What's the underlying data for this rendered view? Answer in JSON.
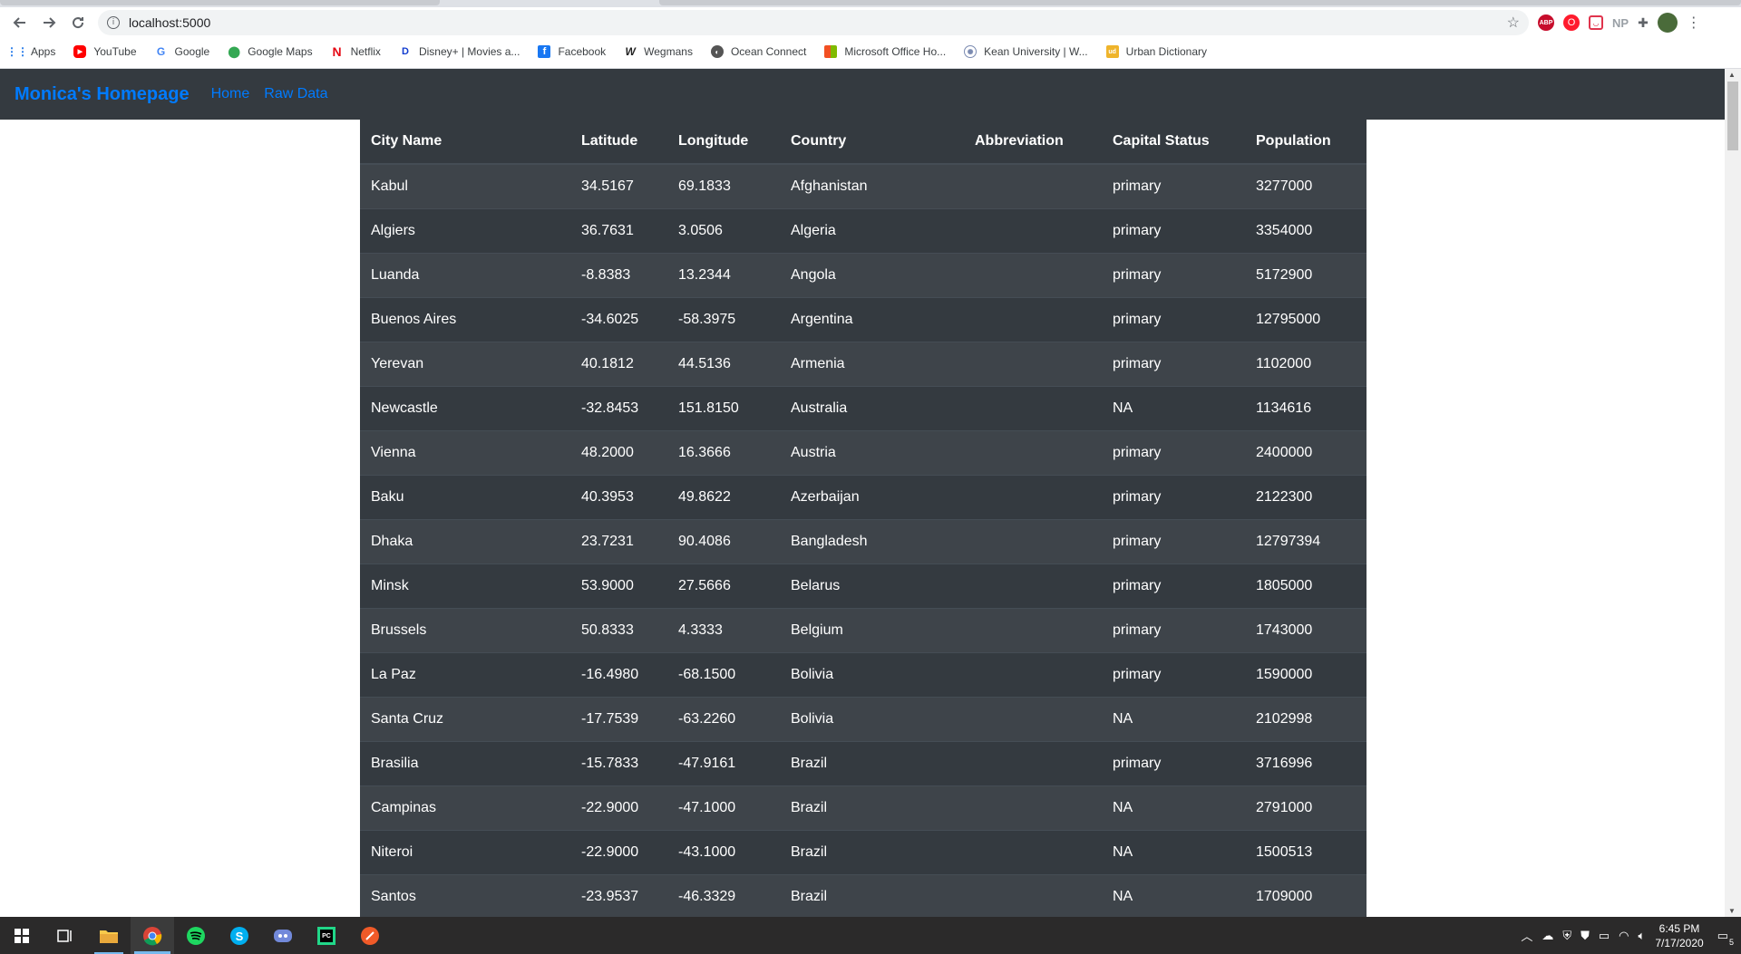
{
  "browser": {
    "url": "localhost:5000",
    "bookmarks": [
      {
        "label": "Apps",
        "icon": "apps-grid-icon"
      },
      {
        "label": "YouTube",
        "icon": "youtube-icon"
      },
      {
        "label": "Google",
        "icon": "google-icon"
      },
      {
        "label": "Google Maps",
        "icon": "google-maps-icon"
      },
      {
        "label": "Netflix",
        "icon": "netflix-icon"
      },
      {
        "label": "Disney+ | Movies a...",
        "icon": "disney-plus-icon"
      },
      {
        "label": "Facebook",
        "icon": "facebook-icon"
      },
      {
        "label": "Wegmans",
        "icon": "wegmans-icon"
      },
      {
        "label": "Ocean Connect",
        "icon": "ocean-connect-icon"
      },
      {
        "label": "Microsoft Office Ho...",
        "icon": "microsoft-office-icon"
      },
      {
        "label": "Kean University | W...",
        "icon": "kean-university-icon"
      },
      {
        "label": "Urban Dictionary",
        "icon": "urban-dictionary-icon"
      }
    ],
    "extensions": {
      "abp": "ABP",
      "np": "NP"
    }
  },
  "navbar": {
    "brand": "Monica's Homepage",
    "links": [
      "Home",
      "Raw Data"
    ]
  },
  "table": {
    "headers": [
      "City Name",
      "Latitude",
      "Longitude",
      "Country",
      "Abbreviation",
      "Capital Status",
      "Population"
    ],
    "rows": [
      [
        "Kabul",
        "34.5167",
        "69.1833",
        "Afghanistan",
        "",
        "primary",
        "3277000"
      ],
      [
        "Algiers",
        "36.7631",
        "3.0506",
        "Algeria",
        "",
        "primary",
        "3354000"
      ],
      [
        "Luanda",
        "-8.8383",
        "13.2344",
        "Angola",
        "",
        "primary",
        "5172900"
      ],
      [
        "Buenos Aires",
        "-34.6025",
        "-58.3975",
        "Argentina",
        "",
        "primary",
        "12795000"
      ],
      [
        "Yerevan",
        "40.1812",
        "44.5136",
        "Armenia",
        "",
        "primary",
        "1102000"
      ],
      [
        "Newcastle",
        "-32.8453",
        "151.8150",
        "Australia",
        "",
        "NA",
        "1134616"
      ],
      [
        "Vienna",
        "48.2000",
        "16.3666",
        "Austria",
        "",
        "primary",
        "2400000"
      ],
      [
        "Baku",
        "40.3953",
        "49.8622",
        "Azerbaijan",
        "",
        "primary",
        "2122300"
      ],
      [
        "Dhaka",
        "23.7231",
        "90.4086",
        "Bangladesh",
        "",
        "primary",
        "12797394"
      ],
      [
        "Minsk",
        "53.9000",
        "27.5666",
        "Belarus",
        "",
        "primary",
        "1805000"
      ],
      [
        "Brussels",
        "50.8333",
        "4.3333",
        "Belgium",
        "",
        "primary",
        "1743000"
      ],
      [
        "La Paz",
        "-16.4980",
        "-68.1500",
        "Bolivia",
        "",
        "primary",
        "1590000"
      ],
      [
        "Santa Cruz",
        "-17.7539",
        "-63.2260",
        "Bolivia",
        "",
        "NA",
        "2102998"
      ],
      [
        "Brasilia",
        "-15.7833",
        "-47.9161",
        "Brazil",
        "",
        "primary",
        "3716996"
      ],
      [
        "Campinas",
        "-22.9000",
        "-47.1000",
        "Brazil",
        "",
        "NA",
        "2791000"
      ],
      [
        "Niteroi",
        "-22.9000",
        "-43.1000",
        "Brazil",
        "",
        "NA",
        "1500513"
      ],
      [
        "Santos",
        "-23.9537",
        "-46.3329",
        "Brazil",
        "",
        "NA",
        "1709000"
      ]
    ]
  },
  "taskbar": {
    "apps": [
      {
        "icon": "windows-start-icon"
      },
      {
        "icon": "task-view-icon"
      },
      {
        "icon": "file-explorer-icon"
      },
      {
        "icon": "chrome-icon"
      },
      {
        "icon": "spotify-icon"
      },
      {
        "icon": "skype-icon"
      },
      {
        "icon": "discord-icon"
      },
      {
        "icon": "pycharm-icon"
      },
      {
        "icon": "paint-icon"
      }
    ],
    "time": "6:45 PM",
    "date": "7/17/2020",
    "notifications": "5"
  }
}
